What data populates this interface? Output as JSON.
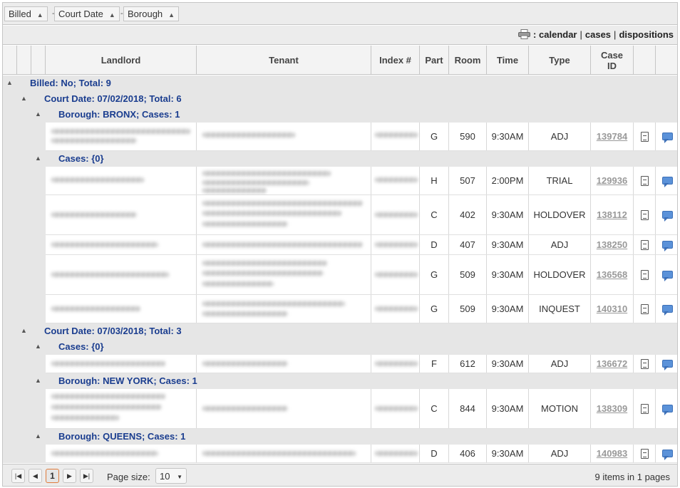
{
  "grouping": {
    "chips": [
      {
        "label": "Billed",
        "sort": "▲"
      },
      {
        "label": "Court Date",
        "sort": "▲"
      },
      {
        "label": "Borough",
        "sort": "▲"
      }
    ]
  },
  "toolbar": {
    "links": [
      "calendar",
      "cases",
      "dispositions"
    ],
    "colon": ":",
    "separator": "|"
  },
  "columns": [
    "Landlord",
    "Tenant",
    "Index #",
    "Part",
    "Room",
    "Time",
    "Type",
    "Case ID"
  ],
  "groups": {
    "g1": "Billed: No; Total: 9",
    "g2": "Court Date: 07/02/2018; Total: 6",
    "g3": "Borough: BRONX; Cases: 1",
    "g4": "Cases: {0}",
    "g5": "Court Date: 07/03/2018; Total: 3",
    "g6": "Cases: {0}",
    "g7": "Borough: NEW YORK; Cases: 1",
    "g8": "Borough: QUEENS; Cases: 1"
  },
  "rows": [
    {
      "part": "G",
      "room": "590",
      "time": "9:30AM",
      "type": "ADJ",
      "case_id": "139784"
    },
    {
      "part": "H",
      "room": "507",
      "time": "2:00PM",
      "type": "TRIAL",
      "case_id": "129936"
    },
    {
      "part": "C",
      "room": "402",
      "time": "9:30AM",
      "type": "HOLDOVER",
      "case_id": "138112"
    },
    {
      "part": "D",
      "room": "407",
      "time": "9:30AM",
      "type": "ADJ",
      "case_id": "138250"
    },
    {
      "part": "G",
      "room": "509",
      "time": "9:30AM",
      "type": "HOLDOVER",
      "case_id": "136568"
    },
    {
      "part": "G",
      "room": "509",
      "time": "9:30AM",
      "type": "INQUEST",
      "case_id": "140310"
    },
    {
      "part": "F",
      "room": "612",
      "time": "9:30AM",
      "type": "ADJ",
      "case_id": "136672"
    },
    {
      "part": "C",
      "room": "844",
      "time": "9:30AM",
      "type": "MOTION",
      "case_id": "138309"
    },
    {
      "part": "D",
      "room": "406",
      "time": "9:30AM",
      "type": "ADJ",
      "case_id": "140983"
    }
  ],
  "icons": {
    "toggle": "▲",
    "print": "printer-icon",
    "doc": "document-icon",
    "chat": "comment-icon"
  },
  "pager": {
    "first": "first-page-icon",
    "prev": "prev-page-icon",
    "next": "next-page-icon",
    "last": "last-page-icon",
    "current_page": "1",
    "page_size_label": "Page size:",
    "page_size": "10",
    "info": "9 items in 1 pages"
  }
}
